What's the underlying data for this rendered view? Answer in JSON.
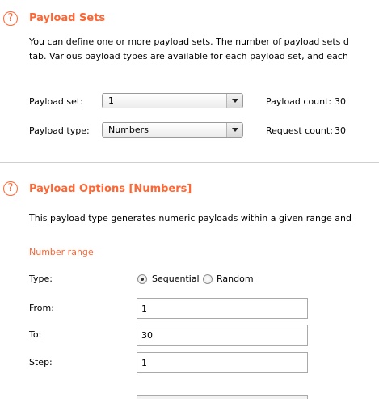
{
  "payload_sets": {
    "title": "Payload Sets",
    "help_glyph": "?",
    "description_line1": "You can define one or more payload sets. The number of payload sets d",
    "description_line2": "tab. Various payload types are available for each payload set, and each",
    "payload_set_label": "Payload set:",
    "payload_set_value": "1",
    "payload_count_label": "Payload count:",
    "payload_count_value": "30",
    "payload_type_label": "Payload type:",
    "payload_type_value": "Numbers",
    "request_count_label": "Request count:",
    "request_count_value": "30"
  },
  "payload_options": {
    "title": "Payload Options [Numbers]",
    "help_glyph": "?",
    "description": "This payload type generates numeric payloads within a given range and",
    "number_range_title": "Number range",
    "type_label": "Type:",
    "type_options": [
      "Sequential",
      "Random"
    ],
    "type_selected": "Sequential",
    "from_label": "From:",
    "from_value": "1",
    "to_label": "To:",
    "to_value": "30",
    "step_label": "Step:",
    "step_value": "1"
  },
  "colors": {
    "accent": "#ff6633",
    "divider": "#cfcfcf"
  },
  "icons": [
    "help-circle-icon",
    "dropdown-arrow-icon",
    "radio-button-icon"
  ]
}
